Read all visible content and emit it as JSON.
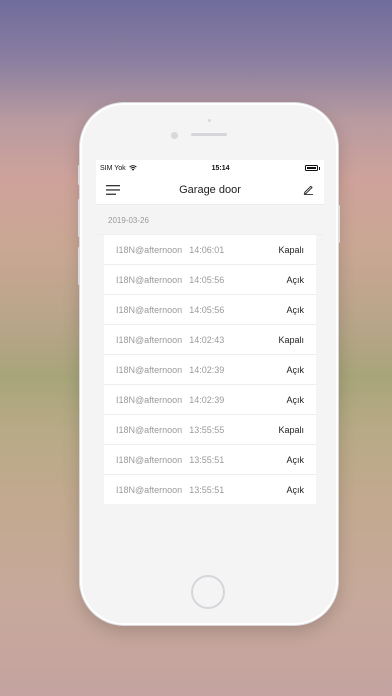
{
  "status_bar": {
    "carrier": "SIM Yok",
    "time": "15:14"
  },
  "nav": {
    "title": "Garage door",
    "menu_icon": "menu-icon",
    "edit_icon": "edit-icon"
  },
  "log": {
    "date": "2019-03-26",
    "entries": [
      {
        "user": "I18N@afternoon",
        "time": "14:06:01",
        "state": "Kapalı"
      },
      {
        "user": "I18N@afternoon",
        "time": "14:05:56",
        "state": "Açık"
      },
      {
        "user": "I18N@afternoon",
        "time": "14:05:56",
        "state": "Açık"
      },
      {
        "user": "I18N@afternoon",
        "time": "14:02:43",
        "state": "Kapalı"
      },
      {
        "user": "I18N@afternoon",
        "time": "14:02:39",
        "state": "Açık"
      },
      {
        "user": "I18N@afternoon",
        "time": "14:02:39",
        "state": "Açık"
      },
      {
        "user": "I18N@afternoon",
        "time": "13:55:55",
        "state": "Kapalı"
      },
      {
        "user": "I18N@afternoon",
        "time": "13:55:51",
        "state": "Açık"
      },
      {
        "user": "I18N@afternoon",
        "time": "13:55:51",
        "state": "Açık"
      }
    ]
  }
}
